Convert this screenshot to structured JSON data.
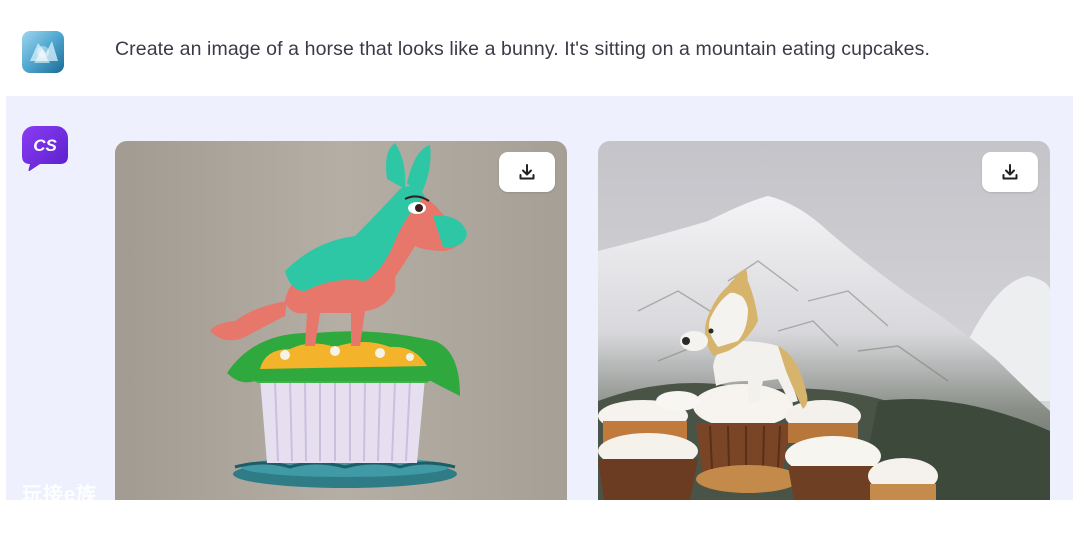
{
  "conversation": {
    "user_message": {
      "avatar_icon": "crystal-avatar-icon",
      "text": "Create an image of a horse that looks like a bunny. It's sitting on a mountain eating cupcakes."
    },
    "assistant_message": {
      "avatar_label": "CS",
      "avatar_color": "#7b2ff2",
      "images": [
        {
          "name": "pink-horse-bunny-on-cupcake",
          "download_icon": "download-icon"
        },
        {
          "name": "white-horse-bunny-on-mountain-cupcakes",
          "download_icon": "download-icon"
        }
      ]
    }
  },
  "watermark": {
    "text": "玩接e族"
  },
  "colors": {
    "assistant_background": "#eef1fd",
    "prompt_text": "#3b3b48"
  }
}
